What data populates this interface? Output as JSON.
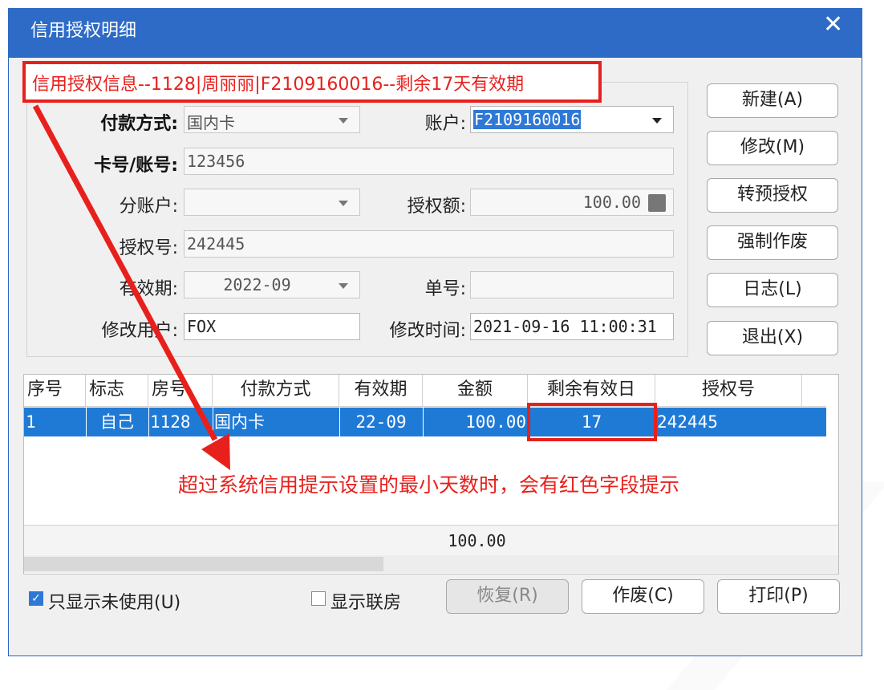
{
  "window": {
    "title": "信用授权明细",
    "close_glyph": "✕"
  },
  "banner": {
    "text": "信用授权信息--1128|周丽丽|F2109160016--剩余17天有效期"
  },
  "form": {
    "payment_label": "付款方式:",
    "payment_value": "国内卡",
    "account_label": "账户:",
    "account_value": "F2109160016",
    "card_label": "卡号/账号:",
    "card_value": "123456",
    "subaccount_label": "分账户:",
    "subaccount_value": "",
    "amount_label": "授权额:",
    "amount_value": "100.00",
    "authno_label": "授权号:",
    "authno_value": "242445",
    "expiry_label": "有效期:",
    "expiry_value": "2022-09",
    "docno_label": "单号:",
    "docno_value": "",
    "modifier_label": "修改用户:",
    "modifier_value": "FOX",
    "modtime_label": "修改时间:",
    "modtime_value": "2021-09-16 11:00:31"
  },
  "side_buttons": {
    "new": "新建(A)",
    "modify": "修改(M)",
    "convert": "转预授权",
    "force_void": "强制作废",
    "log": "日志(L)",
    "exit": "退出(X)"
  },
  "table": {
    "headers": [
      "序号",
      "标志",
      "房号",
      "付款方式",
      "有效期",
      "金额",
      "剩余有效日",
      "授权号"
    ],
    "rows": [
      [
        "1",
        "自己",
        "1128",
        "国内卡",
        "22-09",
        "100.00",
        "17",
        "242445"
      ]
    ],
    "total": "100.00"
  },
  "annotation": {
    "text": "超过系统信用提示设置的最小天数时，会有红色字段提示"
  },
  "bottom": {
    "only_unused": "只显示未使用(U)",
    "only_unused_checked": true,
    "show_linked": "显示联房",
    "show_linked_checked": false,
    "restore": "恢复(R)",
    "void": "作废(C)",
    "print": "打印(P)"
  },
  "colors": {
    "title_bar": "#2e6bc6",
    "selection": "#1f7ad6",
    "annotation_red": "#e8201c"
  }
}
